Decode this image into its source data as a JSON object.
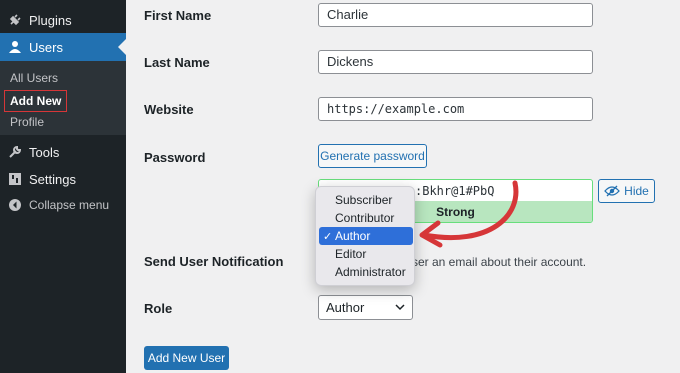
{
  "sidebar": {
    "plugins": "Plugins",
    "users": "Users",
    "all_users": "All Users",
    "add_new": "Add New",
    "profile": "Profile",
    "tools": "Tools",
    "settings": "Settings",
    "collapse": "Collapse menu"
  },
  "form": {
    "first_name_label": "First Name",
    "first_name_value": "Charlie",
    "last_name_label": "Last Name",
    "last_name_value": "Dickens",
    "website_label": "Website",
    "website_value": "https://example.com",
    "password_label": "Password",
    "generate_password": "Generate password",
    "password_value": ":Bkhr@1#PbQ",
    "password_strength": "Strong",
    "hide_button": "Hide",
    "notification_label": "Send User Notification",
    "notification_text": "ser an email about their account.",
    "role_label": "Role",
    "role_value": "Author",
    "submit": "Add New User"
  },
  "role_dropdown": {
    "options": [
      "Subscriber",
      "Contributor",
      "Author",
      "Editor",
      "Administrator"
    ],
    "selected": "Author"
  },
  "colors": {
    "accent": "#2271b1",
    "sidebar": "#1d2327",
    "annotation": "#d63638"
  }
}
